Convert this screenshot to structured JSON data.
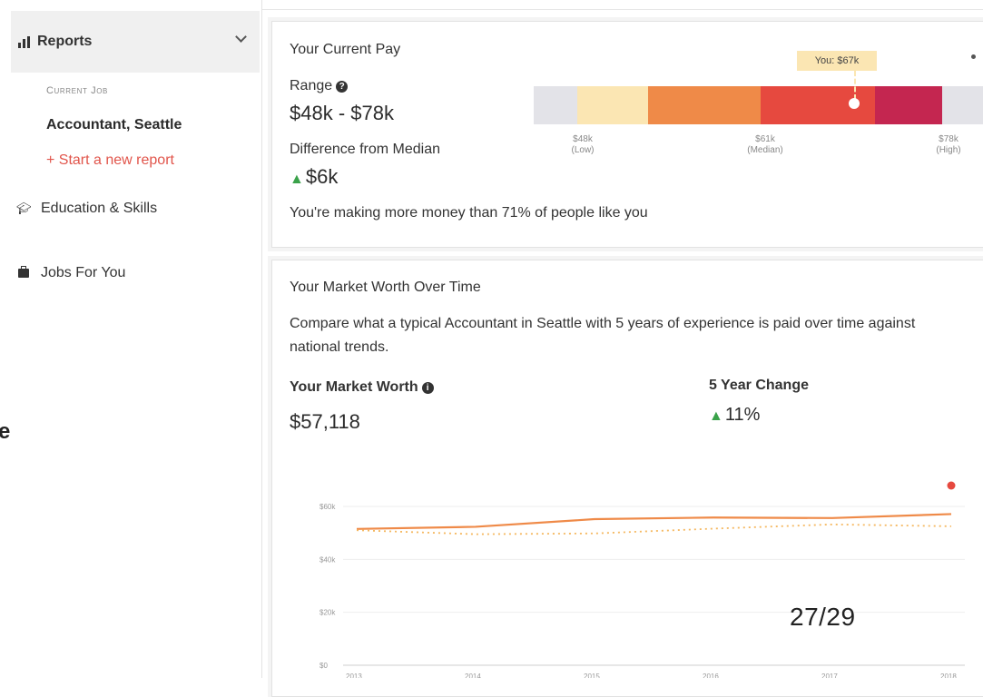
{
  "sidebar": {
    "reports_label": "Reports",
    "current_job_label": "Current Job",
    "job_name": "Accountant, Seattle",
    "new_report": "+ Start a new report",
    "education_label": "Education & Skills",
    "jobs_label": "Jobs For You",
    "cut_off_letter": "e"
  },
  "current_pay": {
    "title": "Your Current Pay",
    "range_label": "Range",
    "range_value": "$48k - $78k",
    "diff_label": "Difference from Median",
    "diff_value": "$6k",
    "summary": "You're making more money than 71% of people like you",
    "you_tag": "You: $67k",
    "ticks": [
      {
        "value": "$48k",
        "caption": "(Low)"
      },
      {
        "value": "$61k",
        "caption": "(Median)"
      },
      {
        "value": "$78k",
        "caption": "(High)"
      }
    ],
    "segment_colors": [
      "#e3e3e8",
      "#fbe6b3",
      "#ef8a48",
      "#e6493f",
      "#c42650",
      "#e3e3e8"
    ]
  },
  "market": {
    "title": "Your Market Worth Over Time",
    "description_line1": "Compare what a typical Accountant in Seattle with 5 years of experience is paid over time against",
    "description_line2": "national trends.",
    "worth_label": "Your Market Worth",
    "worth_value": "$57,118",
    "change_label": "5 Year Change",
    "change_value": "11%"
  },
  "chart_data": {
    "type": "line",
    "x": [
      2013,
      2014,
      2015,
      2016,
      2017,
      2018
    ],
    "ylim": [
      0,
      60000
    ],
    "y_ticks": [
      "$0",
      "$20k",
      "$40k",
      "$60k"
    ],
    "series": [
      {
        "values": [
          51500,
          52300,
          55200,
          55800,
          55600,
          57100
        ],
        "color": "#ef8a48",
        "style": "solid"
      },
      {
        "values": [
          51000,
          49500,
          49800,
          51600,
          53200,
          52500
        ],
        "color": "#f5b860",
        "style": "dashed"
      }
    ],
    "highlight_color": "#e6493f"
  },
  "page_indicator": "27/29"
}
